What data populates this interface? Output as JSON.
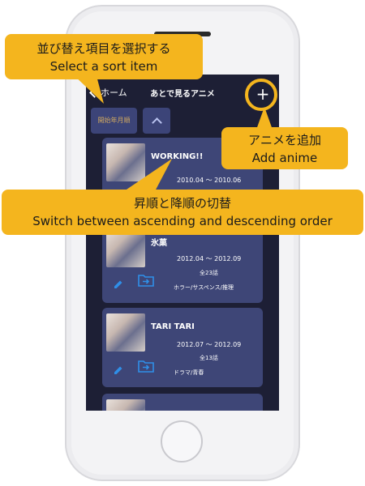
{
  "navbar": {
    "back_label": "ホーム",
    "title": "あとで見るアニメ",
    "add_icon": "plus-icon"
  },
  "sort": {
    "selected": "開始年月順",
    "order_icon": "chevron-up-icon"
  },
  "cards": [
    {
      "title": "WORKING!!",
      "dates": "2010.04 ～ 2010.06",
      "episodes": "",
      "genre": ""
    },
    {
      "title": "氷菓",
      "dates": "2012.04 ～ 2012.09",
      "episodes": "全23話",
      "genre": "ホラー/サスペンス/推理"
    },
    {
      "title": "TARI TARI",
      "dates": "2012.07 ～ 2012.09",
      "episodes": "全13話",
      "genre": "ドラマ/青春"
    },
    {
      "title": "",
      "dates": "",
      "episodes": "",
      "genre": ""
    }
  ],
  "annotations": {
    "sort_item": {
      "jp": "並び替え項目を選択する",
      "en": "Select a sort item"
    },
    "add_anime": {
      "jp": "アニメを追加",
      "en": "Add anime"
    },
    "order_switch": {
      "jp": "昇順と降順の切替",
      "en": "Switch between ascending and descending order"
    }
  },
  "colors": {
    "screen_bg": "#1d1f35",
    "card_bg": "#3e4677",
    "accent": "#2f8fe8",
    "callout": "#f4b51e"
  }
}
